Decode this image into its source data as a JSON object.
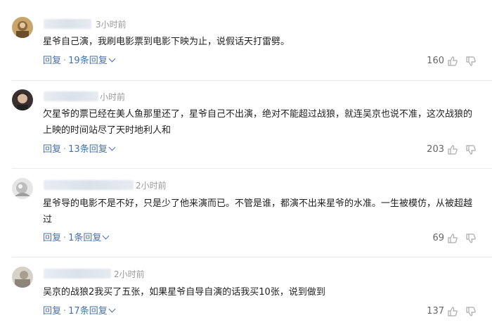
{
  "comments": [
    {
      "time": "3小时前",
      "text": "星爷自己演，我刷电影票到电影下映为止，说假话天打雷劈。",
      "reply": "回复",
      "reply_count": "19条回复",
      "likes": "160"
    },
    {
      "time": "小时前",
      "text": "欠星爷的票已经在美人鱼那里还了，星爷自己不出演，绝对不能超过战狼，就连吴京也说不准，这次战狼的上映的时间站尽了天时地利人和",
      "reply": "回复",
      "reply_count": "13条回复",
      "likes": "203"
    },
    {
      "time": "2小时前",
      "text": "星爷导的电影不是不好，只是少了他来演而已。不管是谁，都演不出来星爷的水准。一生被模仿，从被超越过",
      "reply": "回复",
      "reply_count": "1条回复",
      "likes": "69"
    },
    {
      "time": "2小时前",
      "text": "吴京的战狼2我买了五张，如果星爷自导自演的话我买10张，说到做到",
      "reply": "回复",
      "reply_count": "17条回复",
      "likes": "137"
    }
  ],
  "icons": {
    "like": "thumbs-up-icon",
    "dislike": "thumbs-down-icon",
    "expand": "chevron-down-icon"
  },
  "colors": {
    "link": "#4a6fa5",
    "time": "#999999",
    "text": "#222222",
    "divider": "#ebebeb"
  }
}
